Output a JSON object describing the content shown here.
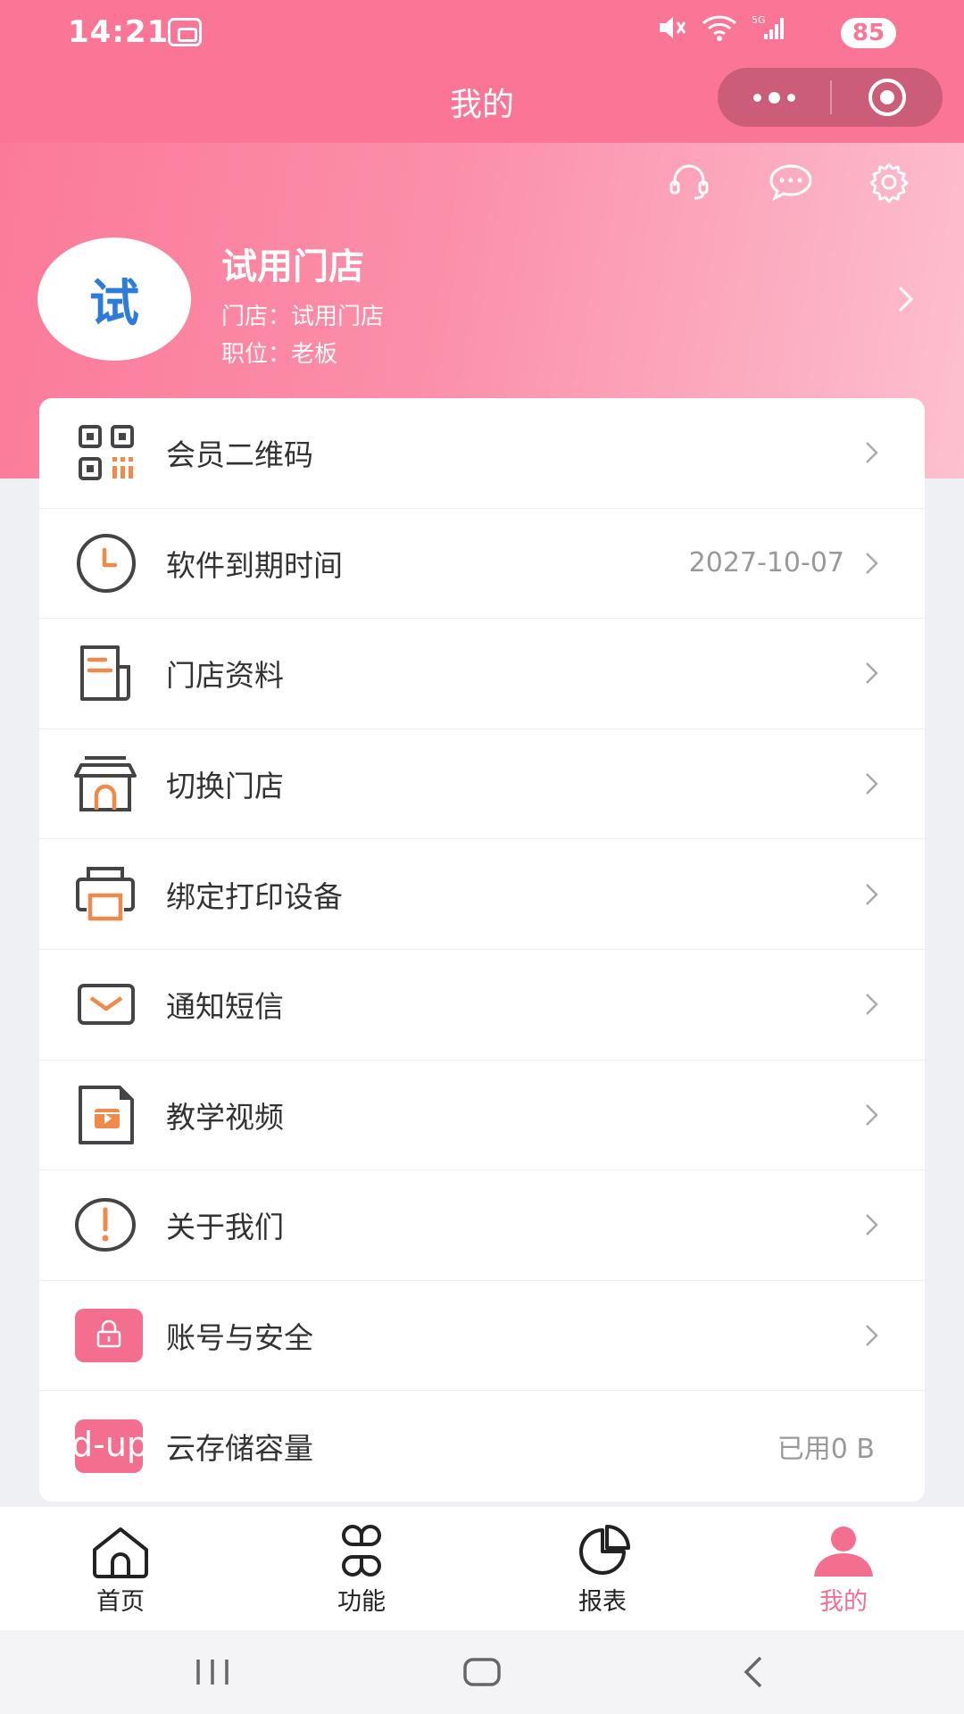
{
  "status_bar": {
    "time": "14:21",
    "battery": "85",
    "network": "5G"
  },
  "header": {
    "title": "我的"
  },
  "profile": {
    "avatar_text": "试",
    "name": "试用门店",
    "store_label": "门店：",
    "store_value": "试用门店",
    "position_label": "职位：",
    "position_value": "老板"
  },
  "menu": [
    {
      "label": "会员二维码",
      "icon": "qr-code-icon"
    },
    {
      "label": "软件到期时间",
      "value": "2027-10-07",
      "icon": "clock-icon"
    },
    {
      "label": "门店资料",
      "icon": "document-icon"
    },
    {
      "label": "切换门店",
      "icon": "store-icon"
    },
    {
      "label": "绑定打印设备",
      "icon": "printer-icon"
    },
    {
      "label": "通知短信",
      "icon": "envelope-icon"
    },
    {
      "label": "教学视频",
      "icon": "video-file-icon"
    },
    {
      "label": "关于我们",
      "icon": "info-icon"
    },
    {
      "label": "账号与安全",
      "icon": "lock-icon"
    },
    {
      "label": "云存储容量",
      "value": "已用0 B",
      "icon": "cloud-upload-icon",
      "icon_text": "d-up"
    }
  ],
  "tabs": [
    {
      "label": "首页",
      "icon": "home-icon"
    },
    {
      "label": "功能",
      "icon": "grid-icon"
    },
    {
      "label": "报表",
      "icon": "pie-chart-icon"
    },
    {
      "label": "我的",
      "icon": "user-icon",
      "active": true
    }
  ],
  "colors": {
    "brand": "#fb7596",
    "accent_orange": "#f08a4b",
    "active_tab": "#f46e90"
  }
}
